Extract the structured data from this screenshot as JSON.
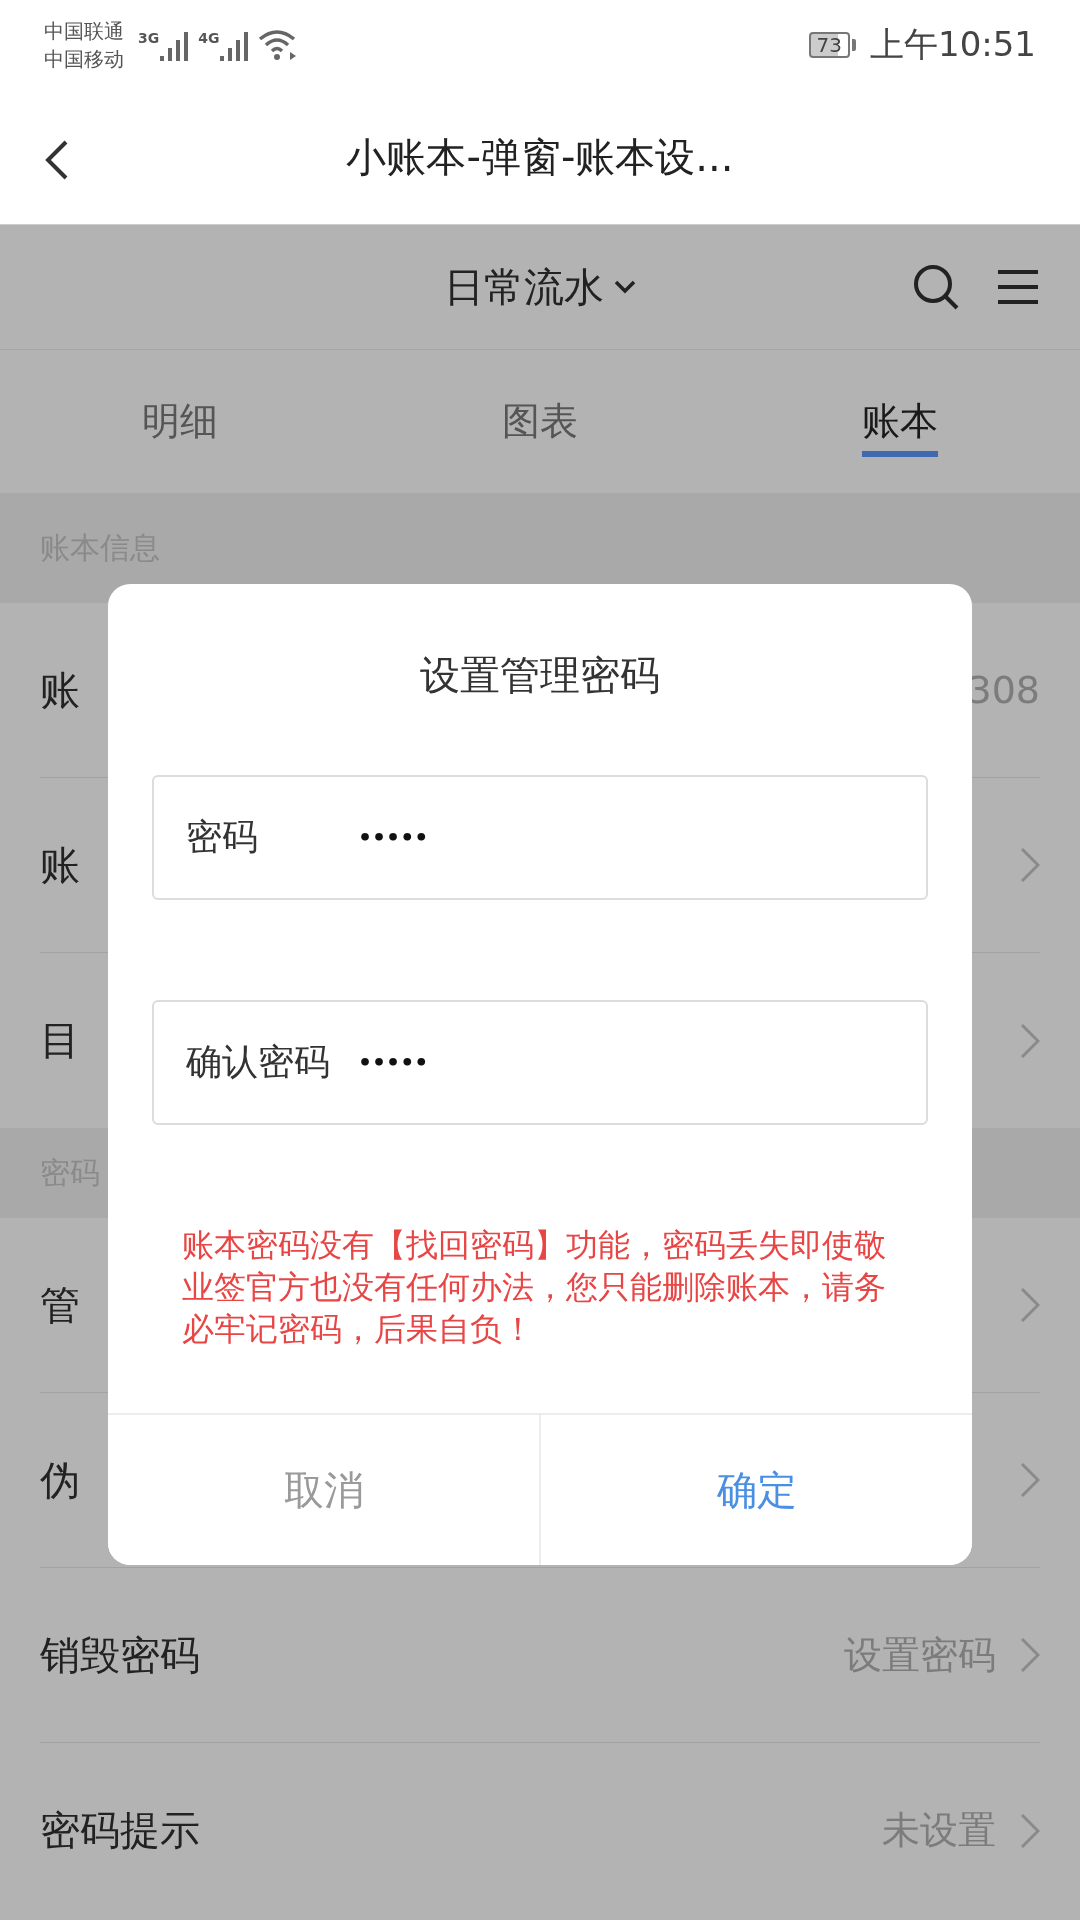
{
  "status_bar": {
    "carriers": [
      "中国联通",
      "中国移动"
    ],
    "networks": [
      "3G",
      "4G"
    ],
    "battery": "73",
    "time": "上午10:51"
  },
  "header": {
    "title": "小账本-弹窗-账本设..."
  },
  "app_bar": {
    "book": "日常流水"
  },
  "tabs": [
    {
      "label": "明细",
      "selected": false
    },
    {
      "label": "图表",
      "selected": false
    },
    {
      "label": "账本",
      "selected": true
    }
  ],
  "sections": [
    {
      "title": "账本信息",
      "rows": [
        {
          "label": "账",
          "value": "308",
          "arrow": false
        },
        {
          "label": "账",
          "arrow": true
        },
        {
          "label": "目",
          "arrow": true
        }
      ]
    },
    {
      "title": "密码",
      "rows": [
        {
          "label": "管",
          "arrow": true
        },
        {
          "label": "伪",
          "arrow": true
        },
        {
          "label": "销毁密码",
          "value": "设置密码",
          "arrow": true
        },
        {
          "label": "密码提示",
          "value": "未设置",
          "arrow": true
        }
      ]
    }
  ],
  "dialog": {
    "title": "设置管理密码",
    "fields": [
      {
        "label": "密码",
        "value": "•••••"
      },
      {
        "label": "确认密码",
        "value": "•••••"
      }
    ],
    "warning": "账本密码没有【找回密码】功能，密码丢失即使敬业签官方也没有任何办法，您只能删除账本，请务必牢记密码，后果自负！",
    "buttons": [
      {
        "label": "取消",
        "kind": "cancel"
      },
      {
        "label": "确定",
        "kind": "confirm"
      }
    ]
  }
}
